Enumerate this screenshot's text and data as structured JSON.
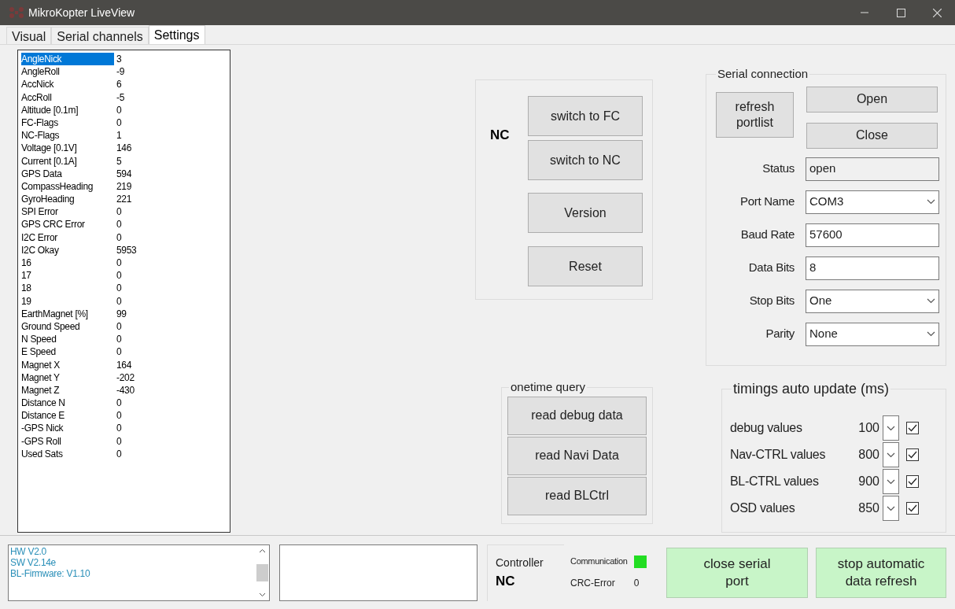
{
  "window": {
    "title": "MikroKopter LiveView"
  },
  "tabs": [
    {
      "label": "Visual",
      "selected": false
    },
    {
      "label": "Serial channels",
      "selected": false
    },
    {
      "label": "Settings",
      "selected": true
    }
  ],
  "debug_list": [
    {
      "name": "AngleNick",
      "value": "3",
      "selected": true
    },
    {
      "name": "AngleRoll",
      "value": "-9",
      "selected": false
    },
    {
      "name": "AccNick",
      "value": "6",
      "selected": false
    },
    {
      "name": "AccRoll",
      "value": "-5",
      "selected": false
    },
    {
      "name": "Altitude [0.1m]",
      "value": "0",
      "selected": false
    },
    {
      "name": "FC-Flags",
      "value": "0",
      "selected": false
    },
    {
      "name": "NC-Flags",
      "value": "1",
      "selected": false
    },
    {
      "name": "Voltage  [0.1V]",
      "value": "146",
      "selected": false
    },
    {
      "name": "Current  [0.1A]",
      "value": "5",
      "selected": false
    },
    {
      "name": "GPS Data",
      "value": "594",
      "selected": false
    },
    {
      "name": "CompassHeading",
      "value": "219",
      "selected": false
    },
    {
      "name": "GyroHeading",
      "value": "221",
      "selected": false
    },
    {
      "name": "SPI Error",
      "value": "0",
      "selected": false
    },
    {
      "name": "GPS CRC Error",
      "value": "0",
      "selected": false
    },
    {
      "name": "I2C Error",
      "value": "0",
      "selected": false
    },
    {
      "name": "I2C Okay",
      "value": "5953",
      "selected": false
    },
    {
      "name": "16",
      "value": "0",
      "selected": false
    },
    {
      "name": "17",
      "value": "0",
      "selected": false
    },
    {
      "name": "18",
      "value": "0",
      "selected": false
    },
    {
      "name": "19",
      "value": "0",
      "selected": false
    },
    {
      "name": "EarthMagnet [%]",
      "value": "99",
      "selected": false
    },
    {
      "name": "Ground Speed",
      "value": "0",
      "selected": false
    },
    {
      "name": "N  Speed",
      "value": "0",
      "selected": false
    },
    {
      "name": "E  Speed",
      "value": "0",
      "selected": false
    },
    {
      "name": "Magnet X",
      "value": "164",
      "selected": false
    },
    {
      "name": "Magnet Y",
      "value": "-202",
      "selected": false
    },
    {
      "name": "Magnet Z",
      "value": "-430",
      "selected": false
    },
    {
      "name": "Distance N",
      "value": "0",
      "selected": false
    },
    {
      "name": "Distance E",
      "value": "0",
      "selected": false
    },
    {
      "name": "-GPS  Nick",
      "value": "0",
      "selected": false
    },
    {
      "name": "-GPS  Roll",
      "value": "0",
      "selected": false
    },
    {
      "name": "Used  Sats",
      "value": "0",
      "selected": false
    }
  ],
  "controller_switch": {
    "current": "NC",
    "buttons": [
      "switch to FC",
      "switch to NC",
      "Version",
      "Reset"
    ]
  },
  "onetime_query": {
    "title": "onetime query",
    "buttons": [
      "read debug data",
      "read Navi Data",
      "read BLCtrl"
    ]
  },
  "serial_connection": {
    "title": "Serial connection",
    "refresh_button": "refresh portlist",
    "open_button": "Open",
    "close_button": "Close",
    "fields": [
      {
        "label": "Status",
        "value": "open",
        "kind": "readonly"
      },
      {
        "label": "Port Name",
        "value": "COM3",
        "kind": "dropdown"
      },
      {
        "label": "Baud Rate",
        "value": "57600",
        "kind": "text"
      },
      {
        "label": "Data Bits",
        "value": "8",
        "kind": "text"
      },
      {
        "label": "Stop Bits",
        "value": "One",
        "kind": "dropdown"
      },
      {
        "label": "Parity",
        "value": "None",
        "kind": "dropdown"
      }
    ]
  },
  "timings": {
    "title": "timings auto update (ms)",
    "rows": [
      {
        "label": "debug values",
        "value": "100",
        "checked": true
      },
      {
        "label": "Nav-CTRL values",
        "value": "800",
        "checked": true
      },
      {
        "label": "BL-CTRL values",
        "value": "900",
        "checked": true
      },
      {
        "label": "OSD values",
        "value": "850",
        "checked": true
      }
    ]
  },
  "status_bar": {
    "version_lines": [
      "HW V2.0",
      "SW V2.14e",
      "BL-Firmware: V1.10"
    ],
    "controller_label": "Controller",
    "controller_value": "NC",
    "communication_label": "Communication",
    "communication_ok": true,
    "crc_label": "CRC-Error",
    "crc_value": "0",
    "close_port_button": "close serial port",
    "stop_refresh_button": "stop automatic data refresh"
  }
}
